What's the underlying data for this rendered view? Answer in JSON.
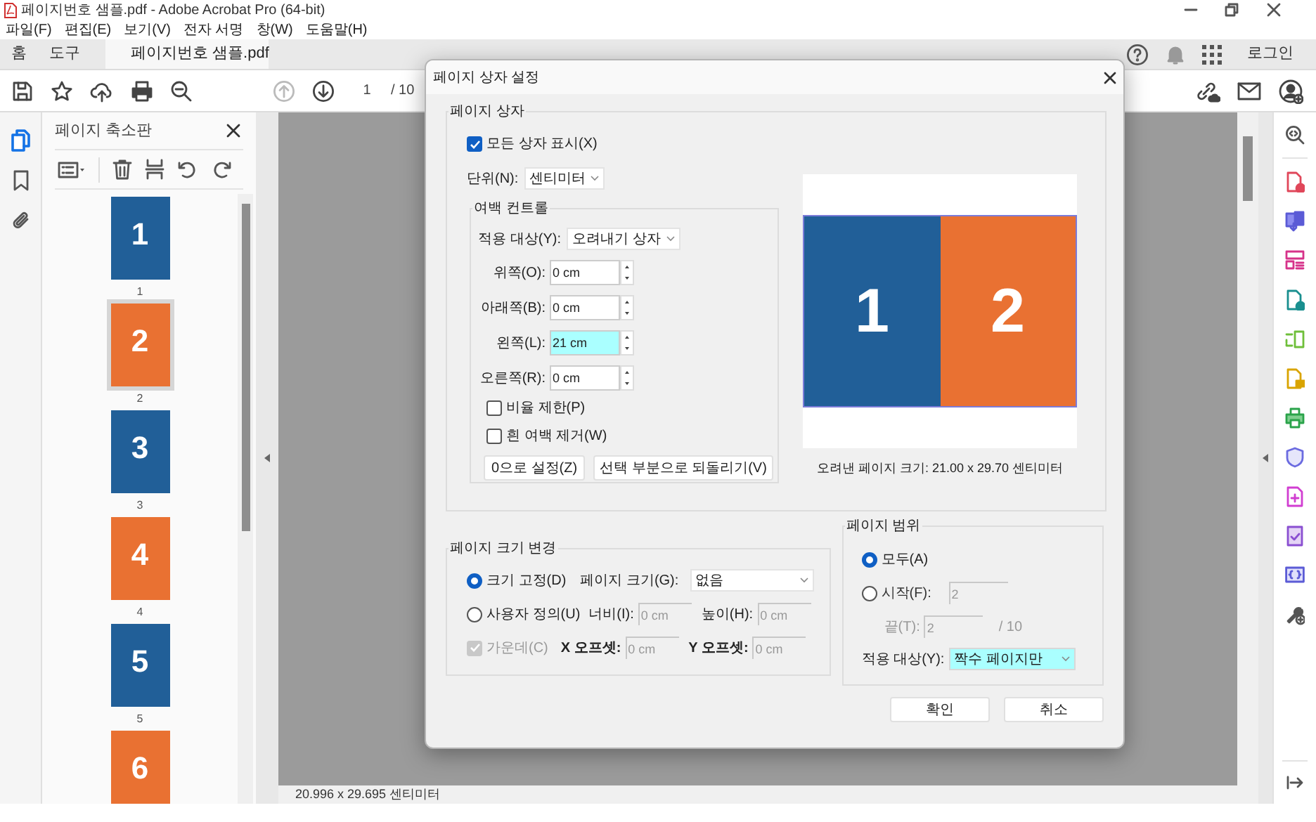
{
  "window": {
    "title": "페이지번호 샘플.pdf - Adobe Acrobat Pro (64-bit)"
  },
  "menu": [
    "파일(F)",
    "편집(E)",
    "보기(V)",
    "전자 서명",
    "창(W)",
    "도움말(H)"
  ],
  "tabs": [
    {
      "label": "홈",
      "selected": false
    },
    {
      "label": "도구",
      "selected": false
    },
    {
      "label": "페이지번호 샘플.pdf",
      "selected": true
    }
  ],
  "account": {
    "login": "로그인"
  },
  "toolbar": {
    "page": "1",
    "total": "/ 10"
  },
  "thumbnails": {
    "title": "페이지 축소판",
    "pages": [
      {
        "number": "1",
        "label": "1",
        "color": "#215f98",
        "selected": false
      },
      {
        "number": "2",
        "label": "2",
        "color": "#e97132",
        "selected": true
      },
      {
        "number": "3",
        "label": "3",
        "color": "#215f98",
        "selected": false
      },
      {
        "number": "4",
        "label": "4",
        "color": "#e97132",
        "selected": false
      },
      {
        "number": "5",
        "label": "5",
        "color": "#215f98",
        "selected": false
      },
      {
        "number": "6",
        "color": "#e97132",
        "selected": false
      }
    ]
  },
  "dialog": {
    "title": "페이지 상자 설정",
    "page_box": {
      "title": "페이지 상자",
      "show_all": {
        "label": "모든 상자 표시(X)",
        "checked": true
      },
      "unit_label": "단위(N):",
      "unit": "센티미터",
      "margins": {
        "title": "여백 컨트롤",
        "apply_label": "적용 대상(Y):",
        "apply": "오려내기 상자",
        "fields": [
          {
            "label": "위쪽(O):",
            "value": "0 cm",
            "highlighted": false
          },
          {
            "label": "아래쪽(B):",
            "value": "0 cm",
            "highlighted": false
          },
          {
            "label": "왼쪽(L):",
            "value": "21 cm",
            "highlighted": true
          },
          {
            "label": "오른쪽(R):",
            "value": "0 cm",
            "highlighted": false
          }
        ],
        "checkboxes": [
          {
            "label": "비율 제한(P)",
            "checked": false
          },
          {
            "label": "흰 여백 제거(W)",
            "checked": false
          }
        ],
        "buttons": [
          "0으로 설정(Z)",
          "선택 부분으로 되돌리기(V)"
        ]
      },
      "preview": {
        "pages": [
          {
            "number": "1",
            "color": "#215f98"
          },
          {
            "number": "2",
            "color": "#e97132"
          }
        ],
        "caption": "오려낸 페이지 크기: 21.00 x 29.70 센티미터"
      }
    },
    "resize": {
      "title": "페이지 크기 변경",
      "options": [
        {
          "label": "크기 고정(D)",
          "selected": true
        },
        {
          "label": "사용자 정의(U)",
          "selected": false
        }
      ],
      "page_size_label": "페이지 크기(G):",
      "page_size": "없음",
      "width_label": "너비(I):",
      "width": "0 cm",
      "height_label": "높이(H):",
      "height": "0 cm",
      "center": {
        "label": "가운데(C)",
        "checked": true,
        "disabled": true
      },
      "x_label": "X 오프셋:",
      "x": "0 cm",
      "y_label": "Y 오프셋:",
      "y": "0 cm"
    },
    "range": {
      "title": "페이지 범위",
      "options": [
        {
          "label": "모두(A)",
          "selected": true
        },
        {
          "label": "시작(F):",
          "selected": false
        }
      ],
      "from": "2",
      "to_label": "끝(T):",
      "to": "2",
      "total": "/ 10",
      "apply_label": "적용 대상(Y):",
      "apply": "짝수 페이지만"
    },
    "buttons": [
      "확인",
      "취소"
    ]
  },
  "status_bar": {
    "size": "20.996 x 29.695 센티미터"
  }
}
